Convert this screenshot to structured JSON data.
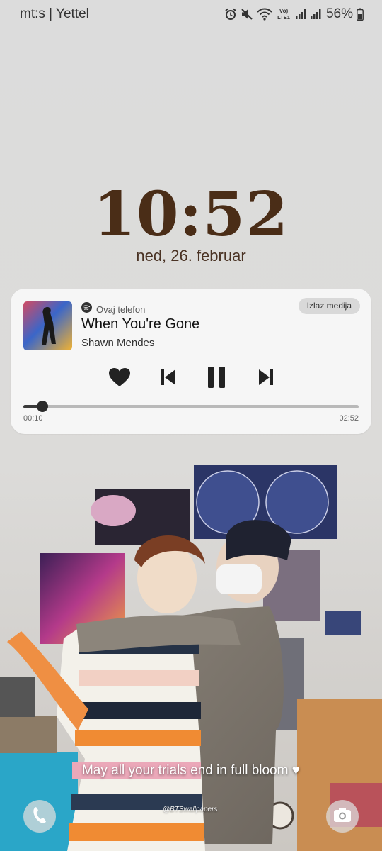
{
  "status_bar": {
    "carrier": "mt:s | Yettel",
    "icons": [
      "alarm-icon",
      "mute-icon",
      "wifi-icon",
      "volte-lte1-icon",
      "signal-icon",
      "signal-icon",
      "battery-icon"
    ],
    "volte_label": "Vo)\nLTE1",
    "battery_percent": "56%"
  },
  "lock_screen": {
    "time": "10:52",
    "date": "ned, 26. februar",
    "caption": "May all your trials end in full bloom ♥",
    "watermark": "@BTSwallpapers",
    "shortcuts": [
      "phone-icon",
      "camera-icon"
    ]
  },
  "media": {
    "source_icon": "spotify-icon",
    "source_label": "Ovaj telefon",
    "exit_button_label": "Izlaz medija",
    "title": "When You're Gone",
    "artist": "Shawn Mendes",
    "controls": [
      "like-heart-icon",
      "previous-track-icon",
      "pause-icon",
      "next-track-icon"
    ],
    "elapsed": "00:10",
    "duration": "02:52",
    "progress_fraction": 0.058
  },
  "colors": {
    "clock": "#4a2d17",
    "card_background": "#f7f7f7",
    "progress_track": "#b9b9b9",
    "progress_fill": "#3a3a3a"
  }
}
